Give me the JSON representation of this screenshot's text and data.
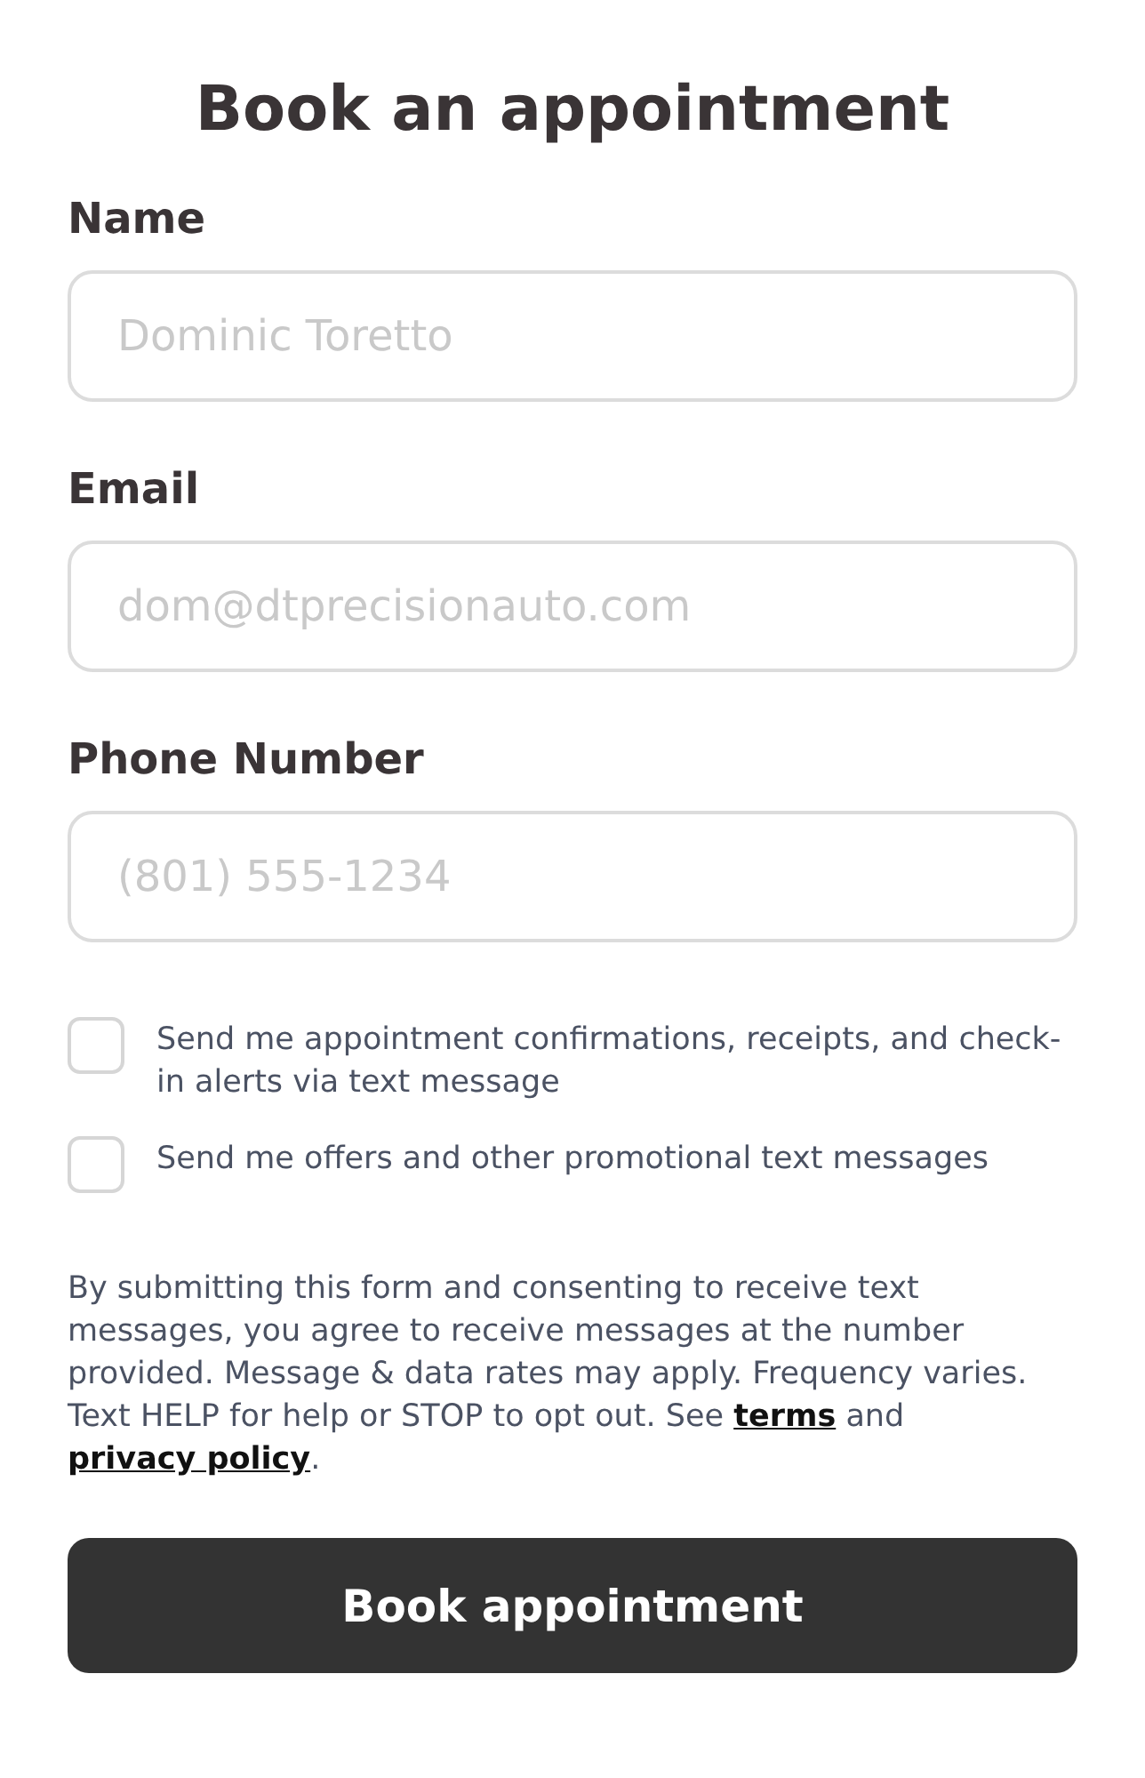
{
  "title": "Book an appointment",
  "fields": [
    {
      "label": "Name",
      "placeholder": "Dominic Toretto"
    },
    {
      "label": "Email",
      "placeholder": "dom@dtprecisionauto.com"
    },
    {
      "label": "Phone Number",
      "placeholder": "(801) 555-1234"
    }
  ],
  "consents": [
    {
      "label": "Send me appointment confirmations, receipts, and check-in alerts via text message",
      "checked": false
    },
    {
      "label": "Send me offers and other promotional text messages",
      "checked": false
    }
  ],
  "disclaimer": {
    "text": "By submitting this form and consenting to receive text messages, you agree to receive messages at the number provided. Message & data rates may apply. Frequency varies. Text HELP for help or STOP to opt out. See",
    "terms_link": "terms",
    "connector": "and",
    "privacy_link": "privacy policy",
    "end": "."
  },
  "submit": "Book appointment"
}
